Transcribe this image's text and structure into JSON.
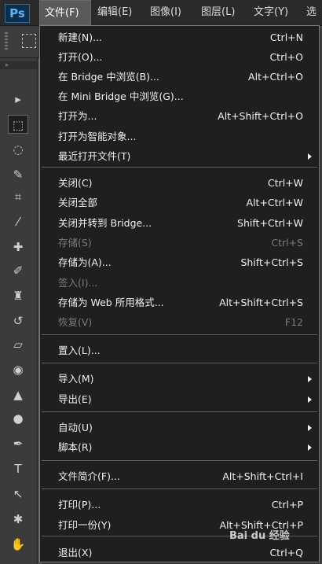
{
  "app": {
    "logo": "Ps"
  },
  "menubar": {
    "items": [
      "文件(F)",
      "编辑(E)",
      "图像(I)",
      "图层(L)",
      "文字(Y)",
      "选"
    ],
    "active_index": 0
  },
  "file_menu": {
    "items": [
      {
        "label": "新建(N)...",
        "shortcut": "Ctrl+N",
        "enabled": true,
        "submenu": false
      },
      {
        "label": "打开(O)...",
        "shortcut": "Ctrl+O",
        "enabled": true,
        "submenu": false
      },
      {
        "label": "在 Bridge 中浏览(B)...",
        "shortcut": "Alt+Ctrl+O",
        "enabled": true,
        "submenu": false
      },
      {
        "label": "在 Mini Bridge 中浏览(G)...",
        "shortcut": "",
        "enabled": true,
        "submenu": false
      },
      {
        "label": "打开为...",
        "shortcut": "Alt+Shift+Ctrl+O",
        "enabled": true,
        "submenu": false
      },
      {
        "label": "打开为智能对象...",
        "shortcut": "",
        "enabled": true,
        "submenu": false
      },
      {
        "label": "最近打开文件(T)",
        "shortcut": "",
        "enabled": true,
        "submenu": true
      },
      {
        "label": "关闭(C)",
        "shortcut": "Ctrl+W",
        "enabled": true,
        "submenu": false
      },
      {
        "label": "关闭全部",
        "shortcut": "Alt+Ctrl+W",
        "enabled": true,
        "submenu": false
      },
      {
        "label": "关闭并转到 Bridge...",
        "shortcut": "Shift+Ctrl+W",
        "enabled": true,
        "submenu": false
      },
      {
        "label": "存储(S)",
        "shortcut": "Ctrl+S",
        "enabled": false,
        "submenu": false
      },
      {
        "label": "存储为(A)...",
        "shortcut": "Shift+Ctrl+S",
        "enabled": true,
        "submenu": false
      },
      {
        "label": "签入(I)...",
        "shortcut": "",
        "enabled": false,
        "submenu": false
      },
      {
        "label": "存储为 Web 所用格式...",
        "shortcut": "Alt+Shift+Ctrl+S",
        "enabled": true,
        "submenu": false
      },
      {
        "label": "恢复(V)",
        "shortcut": "F12",
        "enabled": false,
        "submenu": false
      },
      {
        "label": "置入(L)...",
        "shortcut": "",
        "enabled": true,
        "submenu": false
      },
      {
        "label": "导入(M)",
        "shortcut": "",
        "enabled": true,
        "submenu": true
      },
      {
        "label": "导出(E)",
        "shortcut": "",
        "enabled": true,
        "submenu": true
      },
      {
        "label": "自动(U)",
        "shortcut": "",
        "enabled": true,
        "submenu": true
      },
      {
        "label": "脚本(R)",
        "shortcut": "",
        "enabled": true,
        "submenu": true
      },
      {
        "label": "文件简介(F)...",
        "shortcut": "Alt+Shift+Ctrl+I",
        "enabled": true,
        "submenu": false
      },
      {
        "label": "打印(P)...",
        "shortcut": "Ctrl+P",
        "enabled": true,
        "submenu": false
      },
      {
        "label": "打印一份(Y)",
        "shortcut": "Alt+Shift+Ctrl+P",
        "enabled": true,
        "submenu": false
      },
      {
        "label": "退出(X)",
        "shortcut": "Ctrl+Q",
        "enabled": true,
        "submenu": false
      }
    ]
  },
  "toolbar": {
    "tools": [
      {
        "name": "move-tool-icon",
        "glyph": "▸"
      },
      {
        "name": "marquee-tool-icon",
        "glyph": "⬚"
      },
      {
        "name": "lasso-tool-icon",
        "glyph": "◌"
      },
      {
        "name": "quick-selection-tool-icon",
        "glyph": "✎"
      },
      {
        "name": "crop-tool-icon",
        "glyph": "⌗"
      },
      {
        "name": "eyedropper-tool-icon",
        "glyph": "⁄"
      },
      {
        "name": "healing-brush-tool-icon",
        "glyph": "✚"
      },
      {
        "name": "brush-tool-icon",
        "glyph": "✐"
      },
      {
        "name": "clone-stamp-tool-icon",
        "glyph": "♜"
      },
      {
        "name": "history-brush-tool-icon",
        "glyph": "↺"
      },
      {
        "name": "eraser-tool-icon",
        "glyph": "▱"
      },
      {
        "name": "paint-bucket-tool-icon",
        "glyph": "◉"
      },
      {
        "name": "blur-tool-icon",
        "glyph": "▲"
      },
      {
        "name": "dodge-tool-icon",
        "glyph": "●"
      },
      {
        "name": "pen-tool-icon",
        "glyph": "✒"
      },
      {
        "name": "type-tool-icon",
        "glyph": "T"
      },
      {
        "name": "path-selection-tool-icon",
        "glyph": "↖"
      },
      {
        "name": "custom-shape-tool-icon",
        "glyph": "✱"
      },
      {
        "name": "hand-tool-icon",
        "glyph": "✋"
      }
    ]
  },
  "watermark": "Bai du 经验"
}
